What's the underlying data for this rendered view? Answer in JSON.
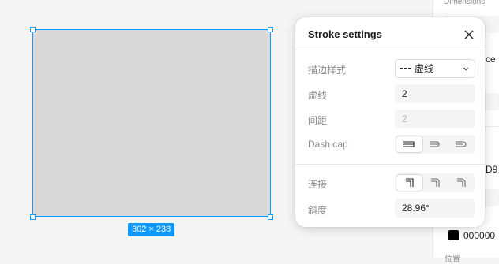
{
  "canvas": {
    "dimensions_badge": "302 × 238"
  },
  "right_panel": {
    "section_title": "Dimensions",
    "fragment_1": "ce",
    "fragment_2": "D9",
    "stroke_hex": "000000",
    "bottom_label": "位置"
  },
  "stroke_popover": {
    "title": "Stroke settings",
    "style_label": "描边样式",
    "style_value": "虚线",
    "dash_label": "虚线",
    "dash_value": "2",
    "gap_label": "间距",
    "gap_value": "2",
    "dash_cap_label": "Dash cap",
    "dash_cap_options": [
      "none-icon",
      "round-cap-icon",
      "square-cap-icon"
    ],
    "dash_cap_selected": 0,
    "join_label": "连接",
    "join_options": [
      "miter-join-icon",
      "round-join-icon",
      "bevel-join-icon"
    ],
    "join_selected": 0,
    "miter_label": "斜度",
    "miter_value": "28.96°"
  },
  "colors": {
    "selection": "#0d99ff",
    "shape_fill": "#d9d9d9"
  }
}
